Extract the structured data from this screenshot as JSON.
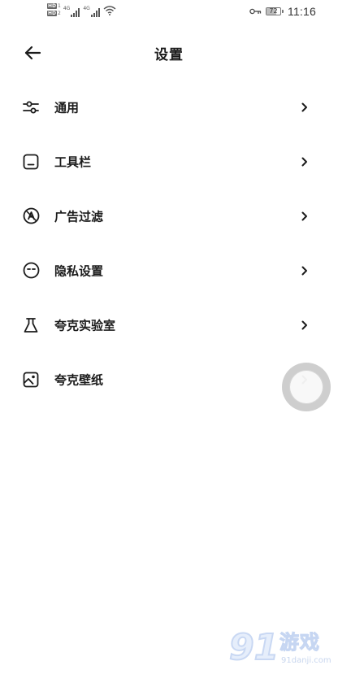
{
  "status_bar": {
    "hd_badge_1": "HD",
    "hd_badge_1_sub": "1",
    "hd_badge_2": "HD",
    "hd_badge_2_sub": "2",
    "signal_1_label": "4G",
    "signal_2_label": "4G",
    "battery_level": "72",
    "battery_fraction": 0.72,
    "time": "11:16",
    "icons": [
      "hd-icon",
      "signal-icon",
      "signal-icon",
      "wifi-icon",
      "key-icon",
      "battery-icon"
    ]
  },
  "header": {
    "back_icon": "back-arrow-icon",
    "title": "设置"
  },
  "settings": {
    "items": [
      {
        "label": "通用",
        "icon": "sliders-icon"
      },
      {
        "label": "工具栏",
        "icon": "toolbar-icon"
      },
      {
        "label": "广告过滤",
        "icon": "ad-filter-icon"
      },
      {
        "label": "隐私设置",
        "icon": "privacy-icon"
      },
      {
        "label": "夸克实验室",
        "icon": "flask-icon"
      },
      {
        "label": "夸克壁纸",
        "icon": "wallpaper-icon"
      }
    ],
    "chevron_icon": "chevron-right-icon"
  },
  "watermark": {
    "number": "91",
    "text": "游戏",
    "url": "91danji.com"
  },
  "colors": {
    "background": "#ffffff",
    "text": "#1b1b1b",
    "watermark": "#c9d8f3"
  }
}
